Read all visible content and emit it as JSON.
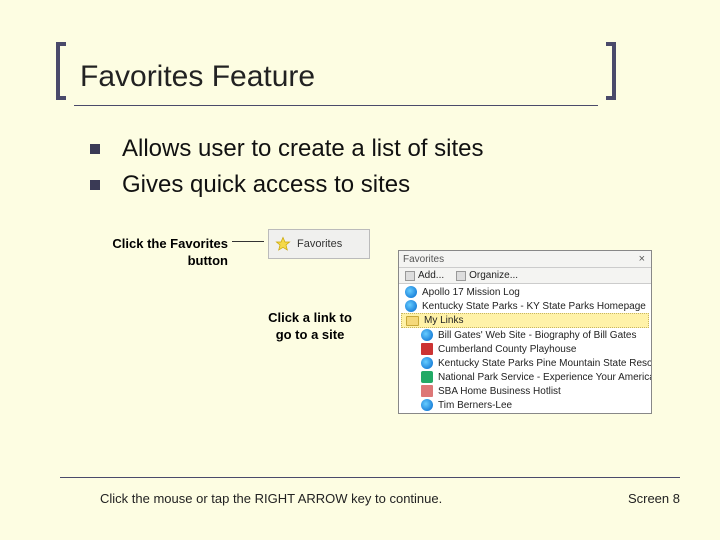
{
  "title": "Favorites Feature",
  "bullets": [
    "Allows user to create a list of sites",
    "Gives quick access to sites"
  ],
  "callout_button": "Click the Favorites button",
  "fav_button_label": "Favorites",
  "callout_link": "Click a link to go to a site",
  "panel": {
    "header": "Favorites",
    "close": "×",
    "toolbar_add": "Add...",
    "toolbar_org": "Organize...",
    "items": [
      {
        "label": "Apollo 17 Mission Log",
        "icon": "ie",
        "indent": false
      },
      {
        "label": "Kentucky State Parks - KY State Parks Homepage",
        "icon": "ie",
        "indent": false
      },
      {
        "label": "My Links",
        "icon": "folder",
        "indent": false,
        "selected": true
      },
      {
        "label": "Bill Gates' Web Site - Biography of Bill Gates",
        "icon": "ie",
        "indent": true
      },
      {
        "label": "Cumberland County Playhouse",
        "icon": "flag",
        "indent": true
      },
      {
        "label": "Kentucky State Parks Pine Mountain State Resort Park",
        "icon": "ie",
        "indent": true
      },
      {
        "label": "National Park Service - Experience Your America",
        "icon": "tree",
        "indent": true
      },
      {
        "label": "SBA Home Business Hotlist",
        "icon": "sba",
        "indent": true
      },
      {
        "label": "Tim Berners-Lee",
        "icon": "ie",
        "indent": true
      }
    ]
  },
  "footer_left": "Click the mouse or tap the RIGHT ARROW key to continue.",
  "footer_right": "Screen 8"
}
